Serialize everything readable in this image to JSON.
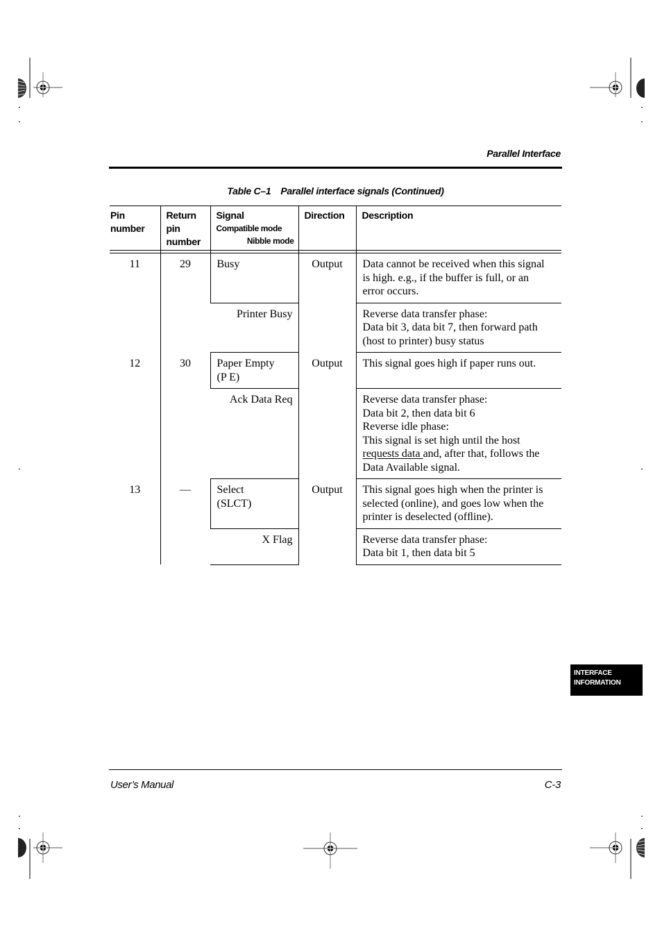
{
  "running_head": "Parallel Interface",
  "caption": {
    "label": "Table C–1",
    "title": "Parallel interface signals (Continued)"
  },
  "table": {
    "headers": {
      "pin": [
        "Pin",
        "number"
      ],
      "return_pin": [
        "Return",
        "pin",
        "number"
      ],
      "signal": "Signal",
      "signal_sub_compatible": "Compatible mode",
      "signal_sub_nibble": "Nibble mode",
      "direction": "Direction",
      "description": "Description"
    },
    "rows": [
      {
        "pin": "11",
        "return_pin": "29",
        "direction": "Output",
        "compatible_signal": [
          "Busy"
        ],
        "compatible_description": [
          "Data cannot be received when this signal",
          "is high. e.g., if the buffer is full, or an",
          "error occurs."
        ],
        "nibble_signal": "Printer Busy",
        "nibble_description": [
          "Reverse data transfer phase:",
          "Data bit 3, data bit 7, then forward path",
          "(host to printer) busy status"
        ]
      },
      {
        "pin": "12",
        "return_pin": "30",
        "direction": "Output",
        "compatible_signal": [
          "Paper Empty",
          "(P E)"
        ],
        "compatible_description": [
          "This signal goes high if paper runs out."
        ],
        "nibble_signal": "Ack Data Req",
        "nibble_description": [
          "Reverse data transfer phase:",
          "Data bit 2, then data bit 6",
          "Reverse idle phase:",
          "This signal is set high until the host"
        ],
        "nibble_description_underlined": "requests data ",
        "nibble_description_tail": [
          "and, after that, follows the",
          "Data Available signal."
        ]
      },
      {
        "pin": "13",
        "return_pin": "—",
        "direction": "Output",
        "compatible_signal": [
          "Select",
          "(SLCT)"
        ],
        "compatible_description": [
          "This signal goes high when the printer is",
          "selected (online), and goes low when the",
          "printer is deselected (ofﬂine)."
        ],
        "nibble_signal": "X Flag",
        "nibble_description": [
          "Reverse data transfer phase:",
          "Data bit 1, then data bit 5"
        ]
      }
    ]
  },
  "side_tab": [
    "INTERFACE",
    "INFORMATION"
  ],
  "footer": {
    "left": "User’s Manual",
    "right": "C-3"
  },
  "icons": {
    "registration_mark": "crosshair-circle",
    "color_bar": "half-circle-striped"
  }
}
